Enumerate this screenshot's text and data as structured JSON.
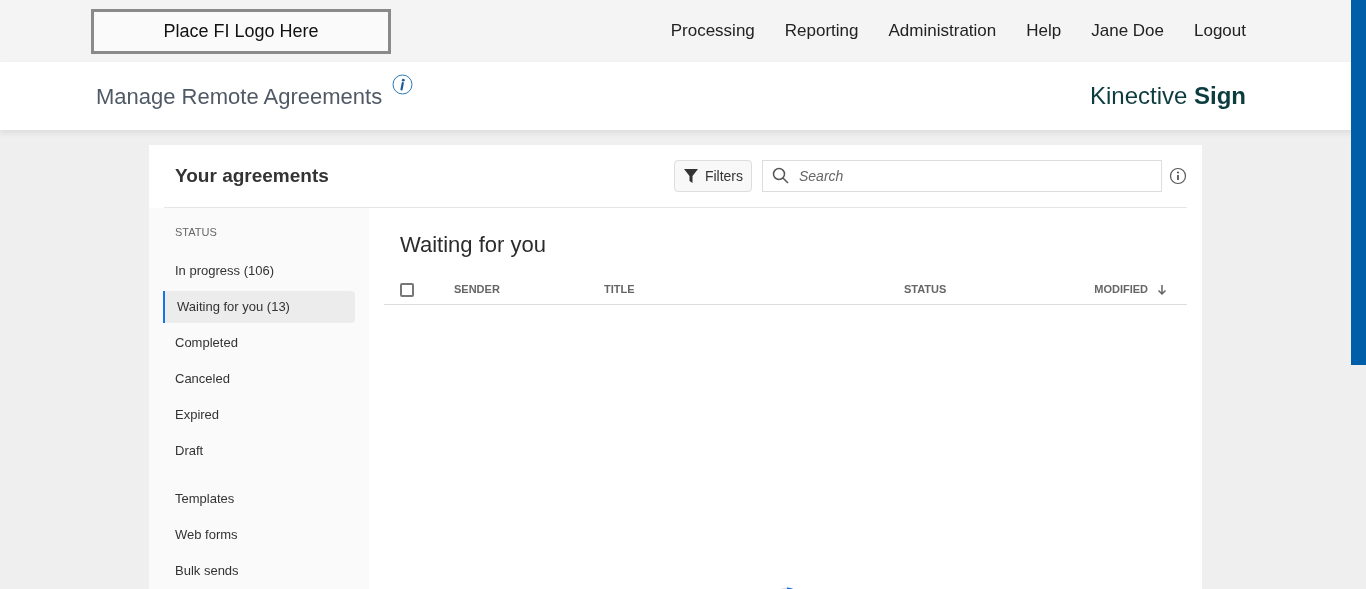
{
  "header": {
    "logo_placeholder": "Place FI Logo Here",
    "nav": [
      {
        "label": "Processing"
      },
      {
        "label": "Reporting"
      },
      {
        "label": "Administration"
      },
      {
        "label": "Help"
      },
      {
        "label": "Jane Doe"
      },
      {
        "label": "Logout"
      }
    ]
  },
  "subheader": {
    "title": "Manage Remote Agreements",
    "brand": "Kinective **Sign**"
  },
  "card": {
    "title": "Your agreements",
    "filters_button": "Filters",
    "search": {
      "placeholder": "Search"
    }
  },
  "sidebar": {
    "section_label": "STATUS",
    "items": [
      {
        "label": "In progress (106)",
        "selected": false
      },
      {
        "label": "Waiting for you (13)",
        "selected": true
      },
      {
        "label": "Completed",
        "selected": false
      },
      {
        "label": "Canceled",
        "selected": false
      },
      {
        "label": "Expired",
        "selected": false
      },
      {
        "label": "Draft",
        "selected": false
      }
    ],
    "extra_items": [
      {
        "label": "Templates"
      },
      {
        "label": "Web forms"
      },
      {
        "label": "Bulk sends"
      }
    ]
  },
  "list": {
    "heading": "Waiting for you",
    "select_all_checked": false,
    "columns": [
      {
        "label": "SENDER"
      },
      {
        "label": "TITLE"
      },
      {
        "label": "STATUS"
      },
      {
        "label": "MODIFIED",
        "sorted": true
      }
    ]
  }
}
